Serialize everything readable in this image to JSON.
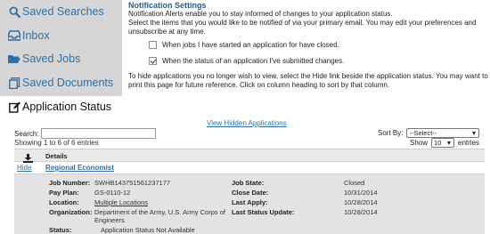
{
  "sidebar": {
    "items": [
      {
        "label": "Saved Searches",
        "icon": "search-icon"
      },
      {
        "label": "Inbox",
        "icon": "inbox-icon"
      },
      {
        "label": "Saved Jobs",
        "icon": "folder-open-icon"
      },
      {
        "label": "Saved Documents",
        "icon": "documents-icon"
      }
    ]
  },
  "notifications": {
    "title": "Notification Settings",
    "intro": "Notification Alerts enable you to stay informed of changes to your application status.",
    "instructions": "Select the items that you would like to be notified of via your primary email. You may edit your preferences and unsubscribe at any time.",
    "options": [
      {
        "label": "When jobs I have started an application for have closed.",
        "checked": false
      },
      {
        "label": "When the status of an application I've submitted changes.",
        "checked": true
      }
    ],
    "hide_info": "To hide applications you no longer wish to view, select the Hide link beside the application status. You may want to print this page for future reference. Click on column heading to sort by that column."
  },
  "app_status": {
    "title": "Application Status",
    "view_hidden": "View Hidden Applications",
    "search_label": "Search:",
    "search_value": "",
    "showing": "Showing 1 to 6 of 6 entries",
    "sort_label": "Sort By:",
    "sort_value": "--Select--",
    "show_label": "Show",
    "show_value": "10",
    "entries_label": "entries",
    "table_header": "Details",
    "row": {
      "hide_label": "Hide",
      "title": "Regional Economist",
      "fields": {
        "job_number_label": "Job Number:",
        "job_number": "SWHB143751561237177",
        "pay_plan_label": "Pay Plan:",
        "pay_plan": "GS-0110-12",
        "location_label": "Location:",
        "location": "Multiple Locations",
        "organization_label": "Organization:",
        "organization": "Department of the Army, U.S. Army Corps of Engineers",
        "status_label": "Status:",
        "status": "Application Status Not Available",
        "job_state_label": "Job State:",
        "job_state": "Closed",
        "close_date_label": "Close Date:",
        "close_date": "10/31/2014",
        "last_apply_label": "Last Apply:",
        "last_apply": "10/28/2014",
        "last_status_update_label": "Last Status Update:",
        "last_status_update": "10/28/2014"
      }
    }
  },
  "colors": {
    "link": "#2f6fa6",
    "sidebar_bg": "#d6d6d6",
    "detail_bg": "#e3e3e3"
  }
}
